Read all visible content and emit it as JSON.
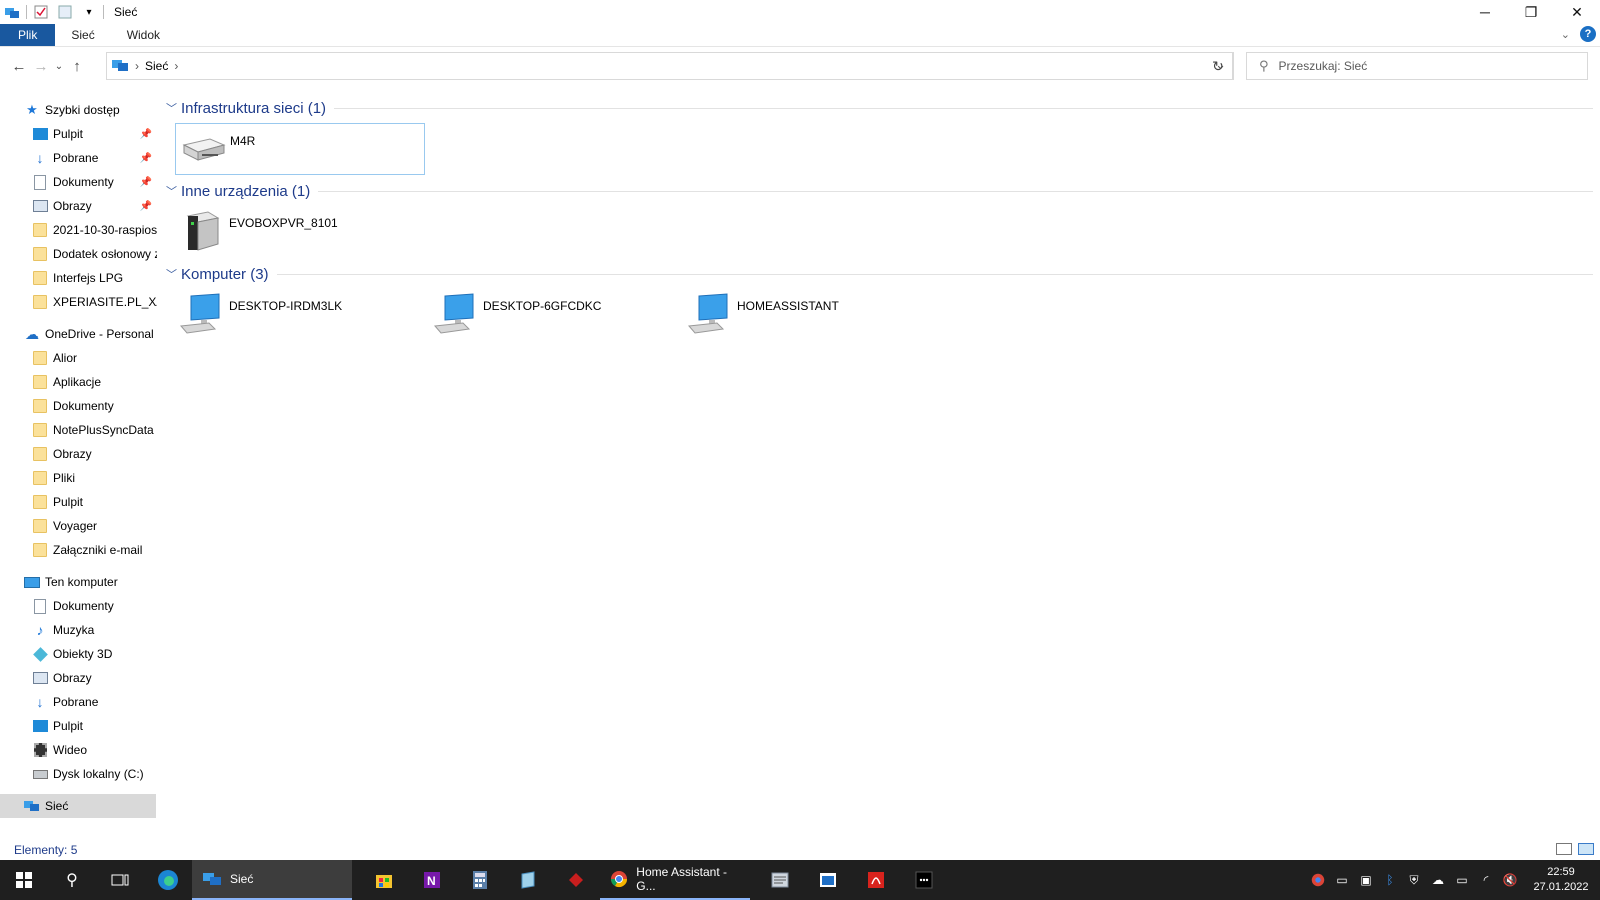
{
  "window": {
    "title": "Sieć"
  },
  "window_controls": {
    "minimize": "─",
    "maximize": "❐",
    "close": "✕"
  },
  "ribbon": {
    "tabs": [
      "Plik",
      "Sieć",
      "Widok"
    ],
    "help": "?"
  },
  "address": {
    "path": [
      "Sieć"
    ],
    "search_placeholder": "Przeszukaj: Sieć"
  },
  "sidebar": {
    "quick_access": {
      "label": "Szybki dostęp",
      "items": [
        "Pulpit",
        "Pobrane",
        "Dokumenty",
        "Obrazy",
        "2021-10-30-raspios-",
        "Dodatek osłonowy z",
        "Interfejs LPG",
        "XPERIASITE.PL_XA1_"
      ]
    },
    "onedrive": {
      "label": "OneDrive - Personal",
      "items": [
        "Alior",
        "Aplikacje",
        "Dokumenty",
        "NotePlusSyncData",
        "Obrazy",
        "Pliki",
        "Pulpit",
        "Voyager",
        "Załączniki e-mail"
      ]
    },
    "this_pc": {
      "label": "Ten komputer",
      "items": [
        "Dokumenty",
        "Muzyka",
        "Obiekty 3D",
        "Obrazy",
        "Pobrane",
        "Pulpit",
        "Wideo",
        "Dysk lokalny (C:)"
      ]
    },
    "network": {
      "label": "Sieć"
    }
  },
  "groups": [
    {
      "title": "Infrastruktura sieci (1)",
      "items": [
        "M4R"
      ]
    },
    {
      "title": "Inne urządzenia (1)",
      "items": [
        "EVOBOXPVR_8101"
      ]
    },
    {
      "title": "Komputer (3)",
      "items": [
        "DESKTOP-IRDM3LK",
        "DESKTOP-6GFCDKC",
        "HOMEASSISTANT"
      ]
    }
  ],
  "status": {
    "items_count": "Elementy: 5"
  },
  "taskbar": {
    "explorer_label": "Sieć",
    "chrome_label": "Home Assistant - G...",
    "clock_time": "22:59",
    "clock_date": "27.01.2022"
  },
  "colors": {
    "accent": "#19589f",
    "group_title": "#1e3b8a",
    "selection_border": "#99c9ef",
    "taskbar": "#1f1f1f"
  }
}
